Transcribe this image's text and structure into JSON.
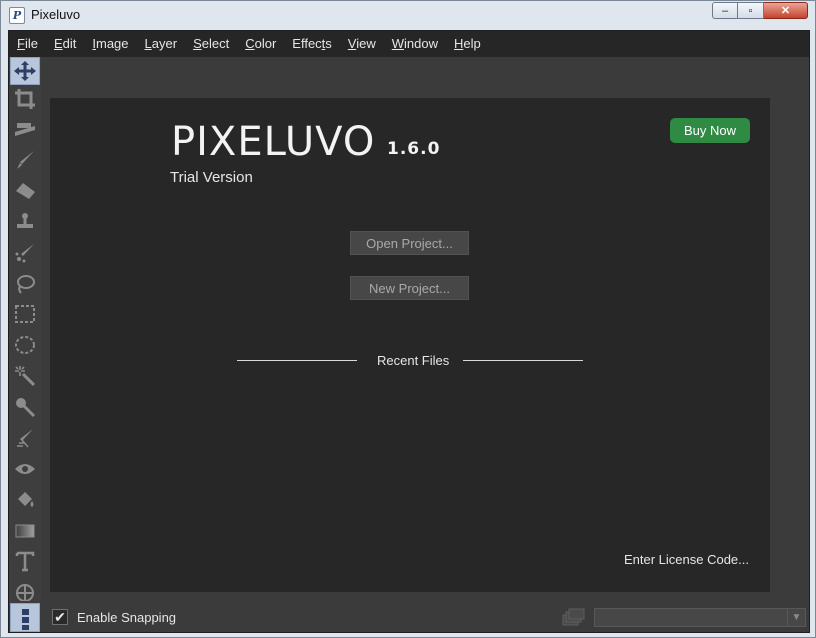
{
  "window": {
    "title": "Pixeluvo",
    "icon_letter": "P",
    "controls": {
      "minimize": "–",
      "maximize": "▫",
      "close": "✕"
    }
  },
  "menubar": {
    "items": [
      {
        "label": "File",
        "mnemonic": "F"
      },
      {
        "label": "Edit",
        "mnemonic": "E"
      },
      {
        "label": "Image",
        "mnemonic": "I"
      },
      {
        "label": "Layer",
        "mnemonic": "L"
      },
      {
        "label": "Select",
        "mnemonic": "S"
      },
      {
        "label": "Color",
        "mnemonic": "C"
      },
      {
        "label": "Effects",
        "mnemonic": "t"
      },
      {
        "label": "View",
        "mnemonic": "V"
      },
      {
        "label": "Window",
        "mnemonic": "W"
      },
      {
        "label": "Help",
        "mnemonic": "H"
      }
    ]
  },
  "toolbar": {
    "tools": [
      {
        "name": "move-tool-icon",
        "active": true
      },
      {
        "name": "crop-tool-icon"
      },
      {
        "name": "straighten-tool-icon"
      },
      {
        "name": "brush-tool-icon"
      },
      {
        "name": "eraser-tool-icon"
      },
      {
        "name": "clone-stamp-tool-icon"
      },
      {
        "name": "healing-tool-icon"
      },
      {
        "name": "lasso-tool-icon"
      },
      {
        "name": "rect-select-tool-icon"
      },
      {
        "name": "ellipse-select-tool-icon"
      },
      {
        "name": "magic-wand-tool-icon"
      },
      {
        "name": "color-picker-tool-icon"
      },
      {
        "name": "smudge-tool-icon"
      },
      {
        "name": "red-eye-tool-icon"
      },
      {
        "name": "fill-bucket-tool-icon"
      },
      {
        "name": "gradient-tool-icon"
      },
      {
        "name": "text-tool-icon"
      },
      {
        "name": "shape-tool-icon"
      }
    ]
  },
  "welcome": {
    "app_name": "PIXELUVO",
    "version": "1.6.0",
    "edition": "Trial Version",
    "buy_label": "Buy Now",
    "open_project_label": "Open Project...",
    "new_project_label": "New Project...",
    "recent_files_label": "Recent Files",
    "license_label": "Enter License Code..."
  },
  "statusbar": {
    "snapping_label": "Enable Snapping",
    "snapping_checked": true,
    "check_glyph": "✔",
    "zoom_value": "",
    "dropdown_glyph": "▼"
  },
  "colors": {
    "buy_button": "#2f8a43",
    "panel_bg": "#272727",
    "workspace_bg": "#3b3b3b",
    "menubar_bg": "#262626",
    "active_tool": "#b8c6dc"
  }
}
